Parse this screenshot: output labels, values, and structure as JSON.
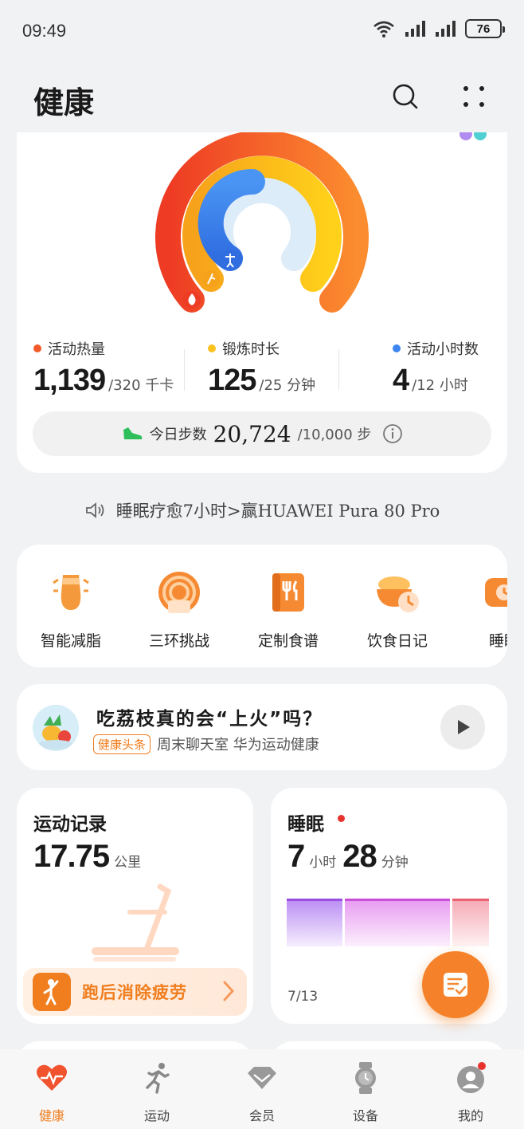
{
  "status_bar": {
    "time": "09:49",
    "battery": "76"
  },
  "header": {
    "title": "健康"
  },
  "rings": {
    "calories": {
      "label": "活动热量",
      "value": "1,139",
      "goal": "/320 千卡",
      "color": "#f2592a"
    },
    "exercise": {
      "label": "锻炼时长",
      "value": "125",
      "goal": "/25 分钟",
      "color": "#fbc11f"
    },
    "active_hours": {
      "label": "活动小时数",
      "value": "4",
      "goal": "/12 小时",
      "color": "#3d85f0"
    }
  },
  "steps": {
    "label": "今日步数",
    "value": "20,724",
    "goal": "/10,000 步"
  },
  "banner": {
    "text": "睡眠疗愈7小时>赢HUAWEI Pura 80 Pro"
  },
  "shortcuts": [
    {
      "label": "智能减脂",
      "icon": "body-shape-icon"
    },
    {
      "label": "三环挑战",
      "icon": "ring-challenge-icon"
    },
    {
      "label": "定制食谱",
      "icon": "recipe-book-icon"
    },
    {
      "label": "饮食日记",
      "icon": "diet-diary-icon"
    },
    {
      "label": "睡眠",
      "icon": "sleep-pillow-icon"
    }
  ],
  "news": {
    "headline": "吃荔枝真的会“上火”吗？",
    "tag": "健康头条",
    "source": "周末聊天室 华为运动健康"
  },
  "exercise_tile": {
    "title": "运动记录",
    "value": "17.75",
    "unit": "公里",
    "promo": "跑后消除疲劳"
  },
  "sleep_tile": {
    "title": "睡眠",
    "hours": "7",
    "hours_unit": "小时",
    "minutes": "28",
    "minutes_unit": "分钟",
    "date": "7/13"
  },
  "tabs": [
    {
      "label": "健康",
      "icon": "heart-icon",
      "active": true
    },
    {
      "label": "运动",
      "icon": "running-icon",
      "active": false
    },
    {
      "label": "会员",
      "icon": "diamond-icon",
      "active": false
    },
    {
      "label": "设备",
      "icon": "watch-icon",
      "active": false
    },
    {
      "label": "我的",
      "icon": "profile-icon",
      "active": false
    }
  ],
  "colors": {
    "accent": "#f07d1e",
    "background": "#f1f2f4"
  }
}
